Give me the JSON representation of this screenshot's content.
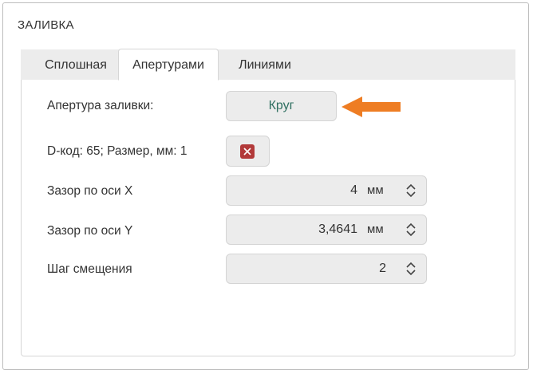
{
  "section": {
    "title": "ЗАЛИВКА"
  },
  "tabs": [
    {
      "label": "Сплошная",
      "active": false
    },
    {
      "label": "Апертурами",
      "active": true
    },
    {
      "label": "Линиями",
      "active": false
    }
  ],
  "aperture": {
    "label": "Апертура заливки:",
    "button_label": "Круг"
  },
  "dcode": {
    "label": "D-код: 65; Размер, мм: 1"
  },
  "gap_x": {
    "label": "Зазор по оси X",
    "value": "4",
    "unit": "мм"
  },
  "gap_y": {
    "label": "Зазор по оси Y",
    "value": "3,4641",
    "unit": "мм"
  },
  "offset_step": {
    "label": "Шаг смещения",
    "value": "2"
  },
  "colors": {
    "accent_text": "#2f6f61",
    "arrow": "#ee7d23",
    "remove": "#b23a3a"
  },
  "icons": {
    "arrow": "arrow-left-icon",
    "remove": "close-icon",
    "stepper": "chevron-up-down-icon"
  }
}
